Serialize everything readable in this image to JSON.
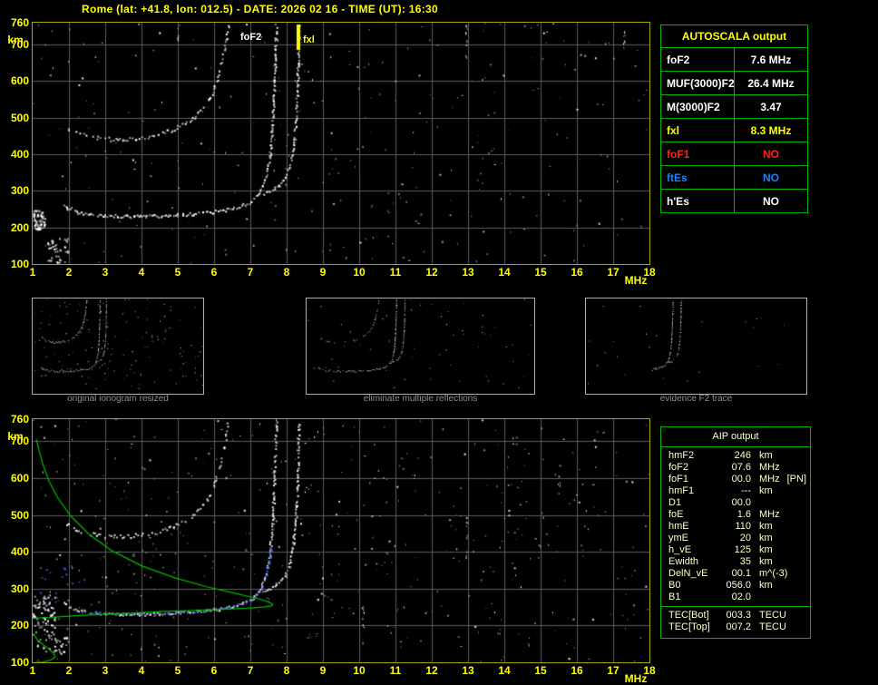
{
  "title": "Rome (lat: +41.8, lon: 012.5) - DATE: 2026 02 16 - TIME (UT): 16:30",
  "colors": {
    "background": "#000000",
    "axis_text": "#ffff00",
    "frame": "#a8a800",
    "grid": "#5d5d5d",
    "trace": "#ffffff",
    "profile_green": "#00bb00",
    "trace_blue": "#4466ff",
    "table_border": "#00b400",
    "caption_gray": "#909090",
    "aip_text": "#ffffc8"
  },
  "axes": {
    "x_ticks": [
      1,
      2,
      3,
      4,
      5,
      6,
      7,
      8,
      9,
      10,
      11,
      12,
      13,
      14,
      15,
      16,
      17,
      18
    ],
    "x_unit": "MHz",
    "y_ticks": [
      760,
      700,
      600,
      500,
      400,
      300,
      200,
      100
    ],
    "y_unit": "km",
    "f_min": 1,
    "f_max": 18,
    "h_min": 100,
    "h_max": 760
  },
  "main_plot": {
    "foF2_label": "foF2",
    "fxl_label": "fxl",
    "fxl_freq": 8.3
  },
  "autoscala_table": {
    "header": "AUTOSCALA output",
    "rows": [
      {
        "label": "foF2",
        "value": "7.6 MHz",
        "color": "#ffffff"
      },
      {
        "label": "MUF(3000)F2",
        "value": "26.4 MHz",
        "color": "#ffffff"
      },
      {
        "label": "M(3000)F2",
        "value": "3.47",
        "color": "#ffffff"
      },
      {
        "label": "fxl",
        "value": "8.3 MHz",
        "color": "#ffff00"
      },
      {
        "label": "foF1",
        "value": "NO",
        "color": "#ff2020"
      },
      {
        "label": "ftEs",
        "value": "NO",
        "color": "#2080ff"
      },
      {
        "label": "h'Es",
        "value": "NO",
        "color": "#ffffff"
      }
    ]
  },
  "thumbnails": [
    {
      "caption": "original ionogram resized"
    },
    {
      "caption": "eliminate multiple reflections"
    },
    {
      "caption": "evidence F2 trace"
    }
  ],
  "aip_table": {
    "header": "AIP output",
    "rows": [
      {
        "label": "hmF2",
        "value": "246",
        "unit": "km",
        "extra": ""
      },
      {
        "label": "foF2",
        "value": "07.6",
        "unit": "MHz",
        "extra": ""
      },
      {
        "label": "foF1",
        "value": "00.0",
        "unit": "MHz",
        "extra": "[PN]"
      },
      {
        "label": "hmF1",
        "value": "---",
        "unit": "km",
        "extra": ""
      },
      {
        "label": "D1",
        "value": "00.0",
        "unit": "",
        "extra": ""
      },
      {
        "label": "foE",
        "value": "1.6",
        "unit": "MHz",
        "extra": ""
      },
      {
        "label": "hmE",
        "value": "110",
        "unit": "km",
        "extra": ""
      },
      {
        "label": "ymE",
        "value": "20",
        "unit": "km",
        "extra": ""
      },
      {
        "label": "h_vE",
        "value": "125",
        "unit": "km",
        "extra": ""
      },
      {
        "label": "Ewidth",
        "value": "35",
        "unit": "km",
        "extra": ""
      },
      {
        "label": "DelN_vE",
        "value": "00.1",
        "unit": "m^(-3)",
        "extra": ""
      },
      {
        "label": "B0",
        "value": "056.0",
        "unit": "km",
        "extra": ""
      },
      {
        "label": "B1",
        "value": "02.0",
        "unit": "",
        "extra": ""
      }
    ],
    "tec_rows": [
      {
        "label": "TEC[Bot]",
        "value": "003.3",
        "unit": "TECU",
        "extra": ""
      },
      {
        "label": "TEC[Top]",
        "value": "007.2",
        "unit": "TECU",
        "extra": ""
      }
    ]
  },
  "chart_data": {
    "type": "scatter",
    "title": "ionogram echo traces (virtual height km vs frequency MHz)",
    "x_range": [
      1,
      18
    ],
    "y_range": [
      100,
      760
    ],
    "traces": {
      "F_trace_omode": [
        [
          1.85,
          262
        ],
        [
          2.0,
          250
        ],
        [
          2.2,
          243
        ],
        [
          2.5,
          238
        ],
        [
          2.8,
          235
        ],
        [
          3.2,
          233
        ],
        [
          3.6,
          232
        ],
        [
          4.0,
          232
        ],
        [
          4.4,
          233
        ],
        [
          4.8,
          235
        ],
        [
          5.2,
          237
        ],
        [
          5.6,
          240
        ],
        [
          6.0,
          244
        ],
        [
          6.3,
          249
        ],
        [
          6.6,
          256
        ],
        [
          6.9,
          266
        ],
        [
          7.1,
          280
        ],
        [
          7.25,
          298
        ],
        [
          7.37,
          322
        ],
        [
          7.46,
          355
        ],
        [
          7.53,
          400
        ],
        [
          7.58,
          455
        ],
        [
          7.62,
          520
        ],
        [
          7.65,
          600
        ],
        [
          7.68,
          690
        ],
        [
          7.7,
          760
        ]
      ],
      "F_trace_xmode": [
        [
          7.35,
          295
        ],
        [
          7.6,
          305
        ],
        [
          7.8,
          320
        ],
        [
          7.95,
          340
        ],
        [
          8.07,
          368
        ],
        [
          8.15,
          405
        ],
        [
          8.21,
          455
        ],
        [
          8.26,
          520
        ],
        [
          8.29,
          600
        ],
        [
          8.31,
          690
        ],
        [
          8.32,
          760
        ]
      ],
      "second_hop": [
        [
          1.9,
          478
        ],
        [
          2.15,
          462
        ],
        [
          2.45,
          452
        ],
        [
          2.8,
          446
        ],
        [
          3.15,
          443
        ],
        [
          3.5,
          443
        ],
        [
          3.85,
          446
        ],
        [
          4.2,
          451
        ],
        [
          4.55,
          459
        ],
        [
          4.9,
          471
        ],
        [
          5.2,
          487
        ],
        [
          5.5,
          508
        ],
        [
          5.75,
          536
        ],
        [
          5.95,
          570
        ],
        [
          6.1,
          612
        ],
        [
          6.22,
          660
        ],
        [
          6.32,
          715
        ],
        [
          6.38,
          760
        ]
      ],
      "autoscala_F2_trace_blue": [
        [
          2.1,
          242
        ],
        [
          2.6,
          237
        ],
        [
          3.2,
          234
        ],
        [
          3.8,
          233
        ],
        [
          4.4,
          234
        ],
        [
          5.0,
          236
        ],
        [
          5.6,
          240
        ],
        [
          6.0,
          245
        ],
        [
          6.4,
          251
        ],
        [
          6.8,
          261
        ],
        [
          7.05,
          274
        ],
        [
          7.22,
          292
        ],
        [
          7.35,
          315
        ],
        [
          7.45,
          345
        ],
        [
          7.52,
          385
        ],
        [
          7.57,
          425
        ]
      ],
      "electron_density_profile": [
        [
          1.0,
          219
        ],
        [
          1.6,
          223
        ],
        [
          2.3,
          227
        ],
        [
          3.0,
          231
        ],
        [
          3.8,
          234
        ],
        [
          4.6,
          238
        ],
        [
          5.4,
          241
        ],
        [
          6.2,
          244
        ],
        [
          6.9,
          247
        ],
        [
          7.35,
          250
        ],
        [
          7.58,
          253
        ],
        [
          7.62,
          257
        ],
        [
          7.5,
          264
        ],
        [
          7.2,
          273
        ],
        [
          6.6,
          287
        ],
        [
          5.8,
          305
        ],
        [
          4.9,
          330
        ],
        [
          4.0,
          362
        ],
        [
          3.2,
          402
        ],
        [
          2.55,
          448
        ],
        [
          2.05,
          497
        ],
        [
          1.7,
          545
        ],
        [
          1.45,
          592
        ],
        [
          1.28,
          638
        ],
        [
          1.17,
          678
        ],
        [
          1.1,
          706
        ]
      ],
      "E_region_profile": [
        [
          1.02,
          178
        ],
        [
          1.12,
          162
        ],
        [
          1.28,
          148
        ],
        [
          1.45,
          136
        ],
        [
          1.58,
          124
        ],
        [
          1.62,
          114
        ],
        [
          1.5,
          106
        ],
        [
          1.3,
          101
        ],
        [
          1.08,
          100
        ]
      ]
    }
  }
}
